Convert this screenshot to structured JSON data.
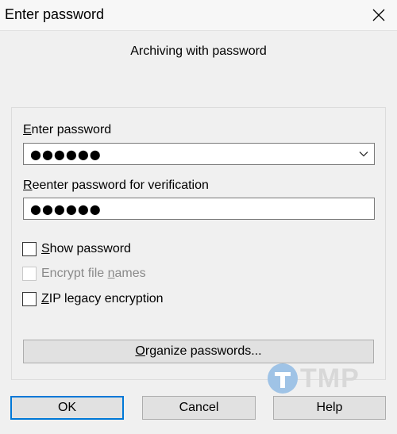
{
  "window": {
    "title": "Enter password",
    "subtitle": "Archiving with password"
  },
  "form": {
    "enter_password_label_u": "E",
    "enter_password_label_rest": "nter password",
    "password_value": "●●●●●●",
    "reenter_label_u": "R",
    "reenter_label_rest": "eenter password for verification",
    "reenter_value": "●●●●●●"
  },
  "options": {
    "show_password_u": "S",
    "show_password_rest": "how password",
    "show_password_checked": false,
    "encrypt_names_pre": "Encrypt file ",
    "encrypt_names_u": "n",
    "encrypt_names_post": "ames",
    "encrypt_names_disabled": true,
    "zip_legacy_u": "Z",
    "zip_legacy_rest": "IP legacy encryption",
    "zip_legacy_checked": false
  },
  "buttons": {
    "organize_u": "O",
    "organize_rest": "rganize passwords...",
    "ok": "OK",
    "cancel": "Cancel",
    "help": "Help"
  },
  "watermark": {
    "text": "TMP"
  },
  "colors": {
    "background": "#f0f0f0",
    "accent": "#0078d7",
    "watermark_blue": "#9fc3e6"
  }
}
